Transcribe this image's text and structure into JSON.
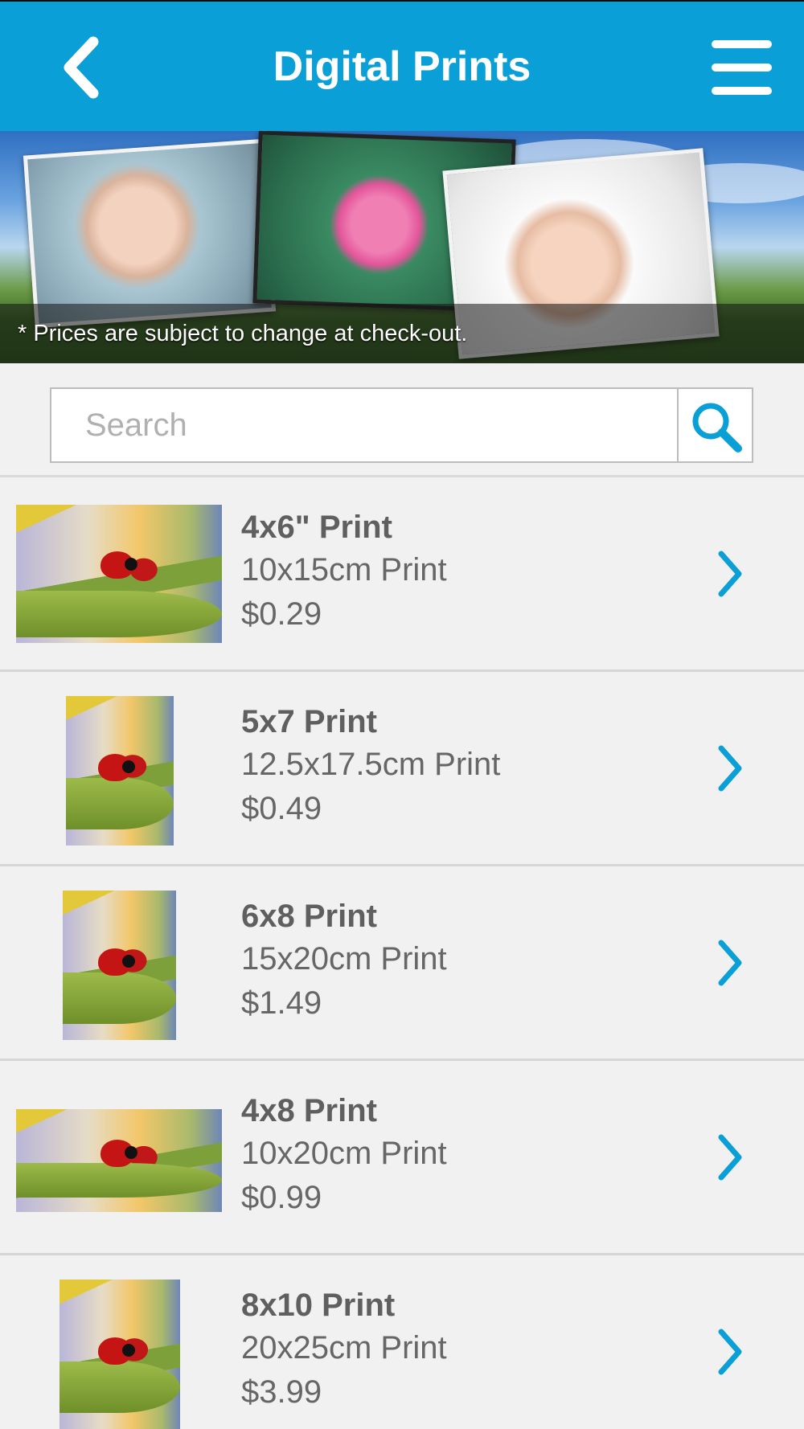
{
  "header": {
    "title": "Digital Prints",
    "back_icon": "chevron-left-icon",
    "menu_icon": "hamburger-menu-icon",
    "background": "#0a9fd6"
  },
  "banner": {
    "notice": "* Prices are subject to change at check-out."
  },
  "search": {
    "placeholder": "Search",
    "value": "",
    "icon": "magnifier-icon"
  },
  "products": [
    {
      "title": "4x6\" Print",
      "subtitle": "10x15cm Print",
      "price": "$0.29"
    },
    {
      "title": "5x7 Print",
      "subtitle": "12.5x17.5cm Print",
      "price": "$0.49"
    },
    {
      "title": "6x8 Print",
      "subtitle": "15x20cm Print",
      "price": "$1.49"
    },
    {
      "title": "4x8 Print",
      "subtitle": "10x20cm Print",
      "price": "$0.99"
    },
    {
      "title": "8x10 Print",
      "subtitle": "20x25cm Print",
      "price": "$3.99"
    }
  ],
  "colors": {
    "accent": "#0a9fd6",
    "text_primary": "#5f5f5f",
    "list_background": "#f1f1f1"
  }
}
